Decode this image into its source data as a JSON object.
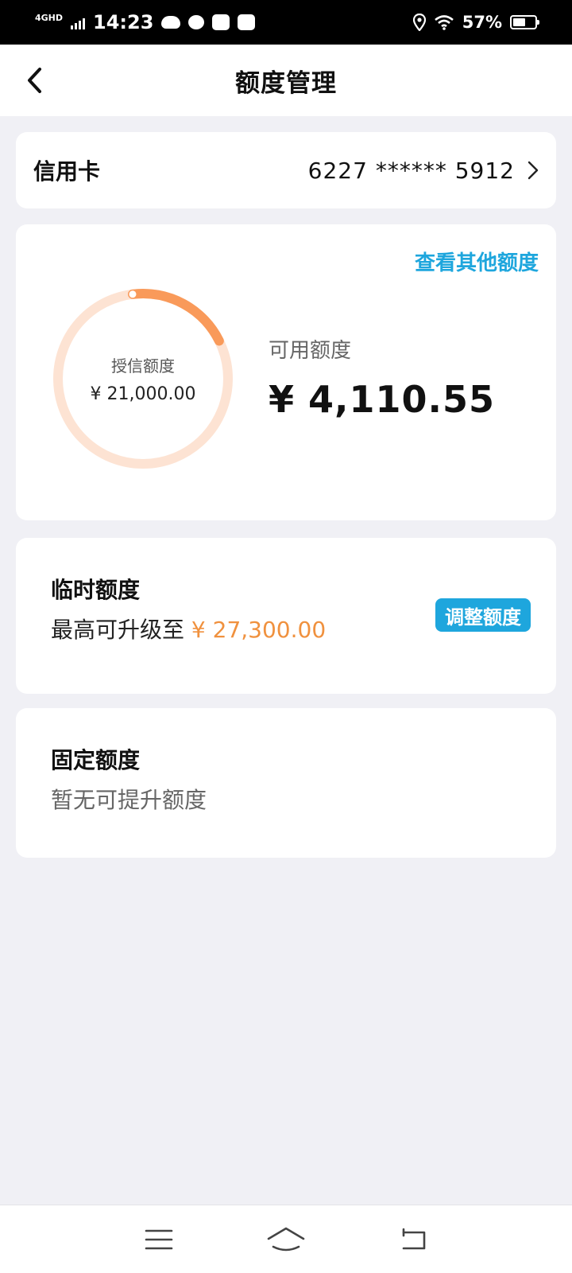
{
  "status_bar": {
    "network": "4GHD",
    "time": "14:23",
    "battery": "57%",
    "battery_level": 0.57
  },
  "header": {
    "title": "额度管理"
  },
  "card": {
    "label": "信用卡",
    "number": "6227 ****** 5912"
  },
  "limit": {
    "other_link": "查看其他额度",
    "credit_label": "授信额度",
    "credit_value": "¥ 21,000.00",
    "available_label": "可用额度",
    "available_value": "¥ 4,110.55",
    "available_fraction": 0.196,
    "ring_track_color": "#fde3d3",
    "ring_fill_color": "#f99a5a"
  },
  "temporary": {
    "title": "临时额度",
    "desc_prefix": "最高可升级至",
    "amount": "¥ 27,300.00",
    "button": "调整额度"
  },
  "fixed": {
    "title": "固定额度",
    "desc": "暂无可提升额度"
  },
  "nav_keys": {
    "menu_icon": "menu-icon",
    "home_icon": "home-icon",
    "back_icon": "return-icon"
  }
}
